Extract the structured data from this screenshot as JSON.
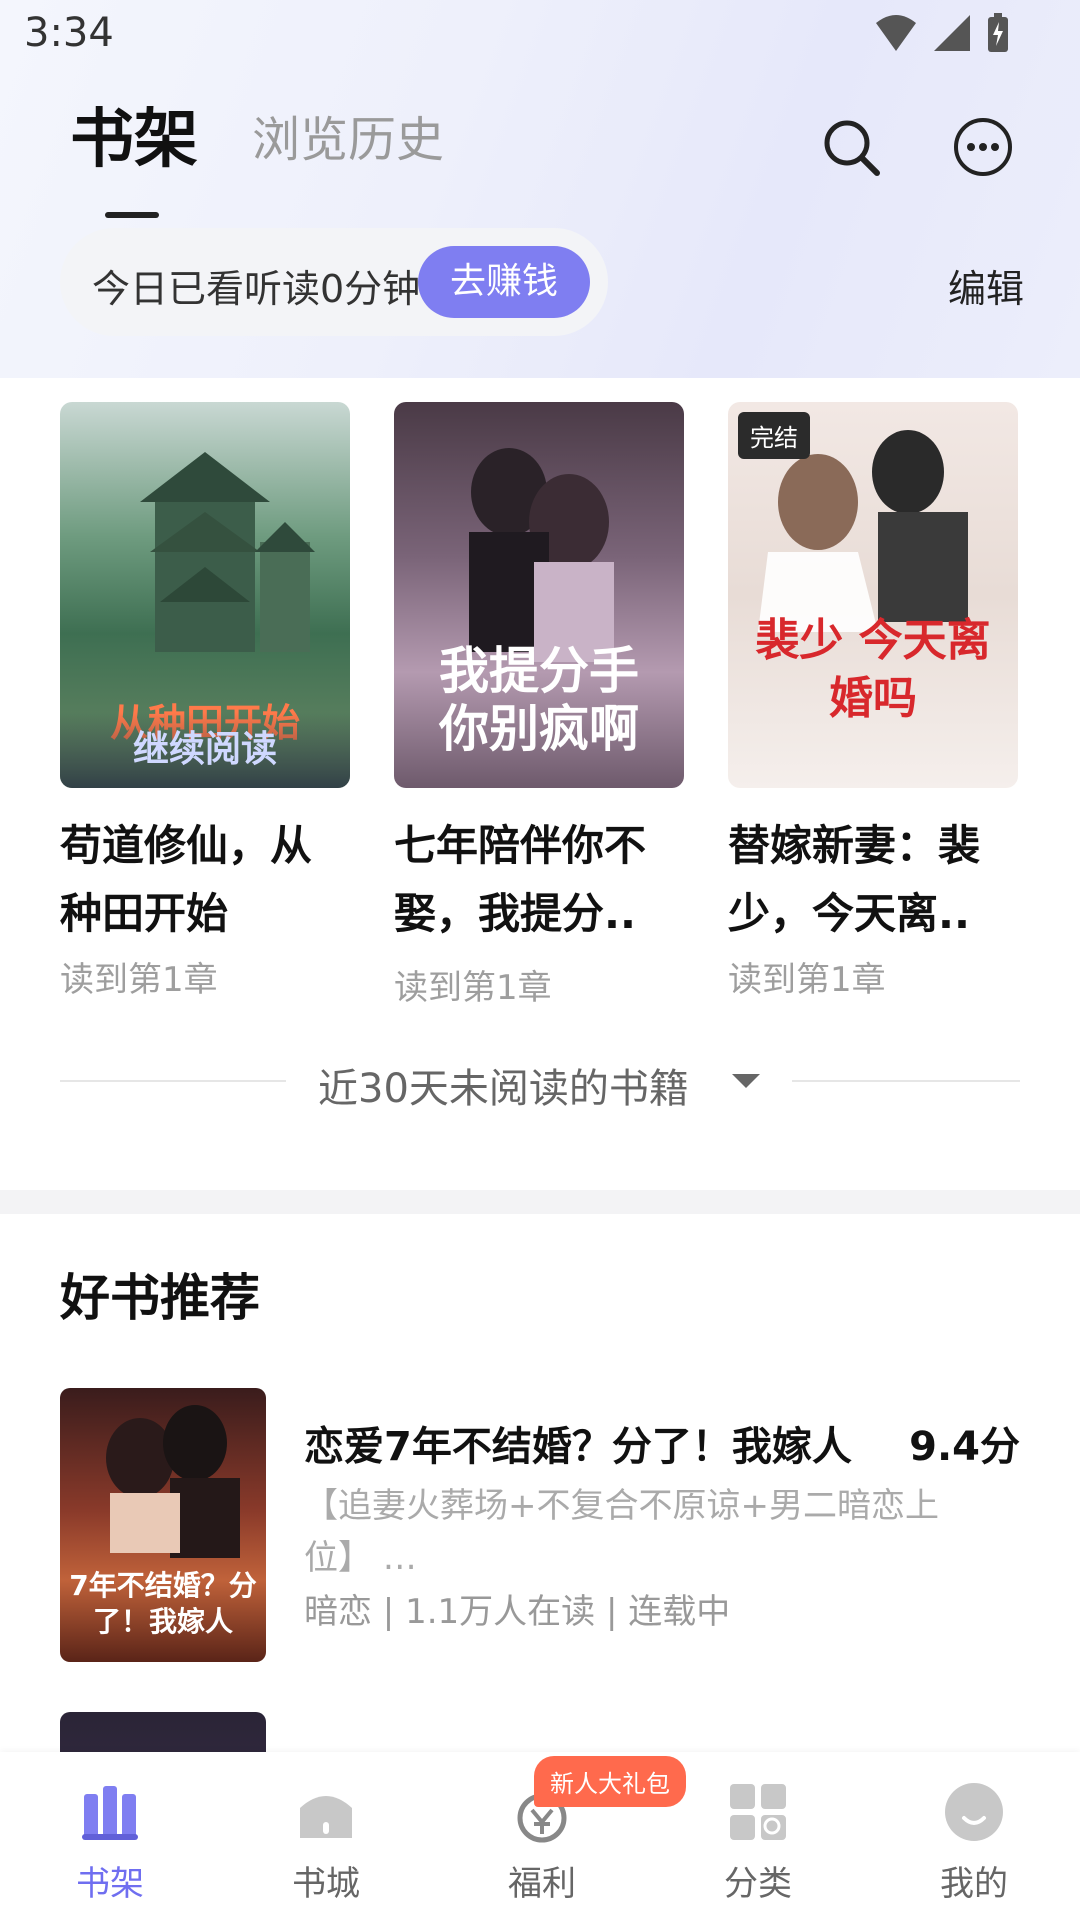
{
  "status_bar": {
    "time": "3:34"
  },
  "header": {
    "tab_active": "书架",
    "tab_history": "浏览历史"
  },
  "read_banner": {
    "text": "今日已看听读0分钟",
    "earn_button": "去赚钱",
    "edit": "编辑"
  },
  "shelf": {
    "books": [
      {
        "title": "苟道修仙，从种田开始",
        "progress": "读到第1章",
        "overlay": "继续阅读",
        "badge": ""
      },
      {
        "title": "七年陪伴你不娶，我提分..",
        "progress": "读到第1章",
        "overlay": "",
        "badge": ""
      },
      {
        "title": "替嫁新妻：裴少，今天离..",
        "progress": "读到第1章",
        "overlay": "",
        "badge": "完结"
      }
    ],
    "cover_texts": [
      "从种田开始",
      "我提分手 你别疯啊",
      "裴少 今天离婚吗"
    ],
    "old_books_label": "近30天未阅读的书籍"
  },
  "recommend": {
    "section_title": "好书推荐",
    "items": [
      {
        "name": "恋爱7年不结婚？分了！我嫁人",
        "score": "9.4分",
        "desc": "【追妻火葬场+不复合不原谅+男二暗恋上位】 …",
        "meta": "暗恋 | 1.1万人在读 | 连载中",
        "cover_text": "7年不结婚？分了！我嫁人"
      }
    ]
  },
  "bottom_nav": {
    "items": [
      "书架",
      "书城",
      "福利",
      "分类",
      "我的"
    ],
    "gift_badge": "新人大礼包"
  },
  "colors": {
    "accent": "#7f7ef1",
    "badge": "#ff6a4d"
  }
}
